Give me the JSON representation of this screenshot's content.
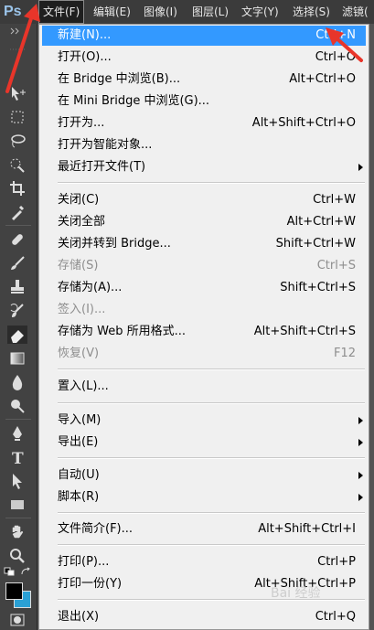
{
  "app": {
    "logo": "Ps"
  },
  "menubar": {
    "items": [
      {
        "label": "文件(F)",
        "active": true
      },
      {
        "label": "编辑(E)"
      },
      {
        "label": "图像(I)"
      },
      {
        "label": "图层(L)"
      },
      {
        "label": "文字(Y)"
      },
      {
        "label": "选择(S)"
      },
      {
        "label": "滤镜("
      }
    ]
  },
  "file_menu": {
    "items": [
      {
        "label": "新建(N)...",
        "shortcut": "Ctrl+N",
        "highlighted": true
      },
      {
        "label": "打开(O)...",
        "shortcut": "Ctrl+O"
      },
      {
        "label": "在 Bridge 中浏览(B)...",
        "shortcut": "Alt+Ctrl+O"
      },
      {
        "label": "在 Mini Bridge 中浏览(G)...",
        "shortcut": ""
      },
      {
        "label": "打开为...",
        "shortcut": "Alt+Shift+Ctrl+O"
      },
      {
        "label": "打开为智能对象...",
        "shortcut": ""
      },
      {
        "label": "最近打开文件(T)",
        "shortcut": "",
        "submenu": true
      },
      {
        "label": "关闭(C)",
        "shortcut": "Ctrl+W"
      },
      {
        "label": "关闭全部",
        "shortcut": "Alt+Ctrl+W"
      },
      {
        "label": "关闭并转到 Bridge...",
        "shortcut": "Shift+Ctrl+W"
      },
      {
        "label": "存储(S)",
        "shortcut": "Ctrl+S",
        "disabled": true
      },
      {
        "label": "存储为(A)...",
        "shortcut": "Shift+Ctrl+S"
      },
      {
        "label": "签入(I)...",
        "shortcut": "",
        "disabled": true
      },
      {
        "label": "存储为 Web 所用格式...",
        "shortcut": "Alt+Shift+Ctrl+S"
      },
      {
        "label": "恢复(V)",
        "shortcut": "F12",
        "disabled": true
      },
      {
        "label": "置入(L)...",
        "shortcut": ""
      },
      {
        "label": "导入(M)",
        "shortcut": "",
        "submenu": true
      },
      {
        "label": "导出(E)",
        "shortcut": "",
        "submenu": true
      },
      {
        "label": "自动(U)",
        "shortcut": "",
        "submenu": true
      },
      {
        "label": "脚本(R)",
        "shortcut": "",
        "submenu": true
      },
      {
        "label": "文件简介(F)...",
        "shortcut": "Alt+Shift+Ctrl+I"
      },
      {
        "label": "打印(P)...",
        "shortcut": "Ctrl+P"
      },
      {
        "label": "打印一份(Y)",
        "shortcut": "Alt+Shift+Ctrl+P"
      },
      {
        "label": "退出(X)",
        "shortcut": "Ctrl+Q"
      }
    ]
  },
  "colors": {
    "highlight": "#3399ff",
    "annotation": "#e8352a",
    "foreground_swatch": "#000000",
    "background_swatch": "#2aa0d4"
  },
  "watermark": "Bai 经验"
}
